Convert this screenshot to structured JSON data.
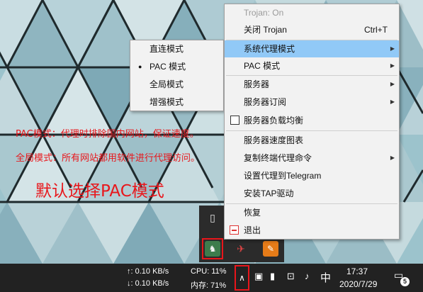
{
  "annotations": {
    "pac_mode": "PAC模式：代理时排除国内网站，保证速度。",
    "global_mode": "全局模式：所有网站都用软件进行代理访问。",
    "default_choice": "默认选择PAC模式"
  },
  "context_menu": {
    "status": "Trojan: On",
    "close_trojan": "关闭 Trojan",
    "close_shortcut": "Ctrl+T",
    "system_proxy_mode": "系统代理模式",
    "pac_mode": "PAC 模式",
    "servers": "服务器",
    "server_subscription": "服务器订阅",
    "server_load_balance": "服务器负载均衡",
    "server_speed_chart": "服务器速度图表",
    "copy_terminal_proxy_cmd": "复制终端代理命令",
    "set_proxy_telegram": "设置代理到Telegram",
    "install_tap_driver": "安装TAP驱动",
    "restore": "恢复",
    "exit": "退出"
  },
  "proxy_submenu": {
    "items": [
      "直连模式",
      "PAC 模式",
      "全局模式",
      "增强模式"
    ],
    "selected_index": 1
  },
  "taskbar": {
    "net_up": "↑: 0.10 KB/s",
    "net_down": "↓: 0.10 KB/s",
    "cpu": "CPU: 11%",
    "memory": "内存: 71%",
    "ime": "中",
    "time": "17:37",
    "date": "2020/7/29",
    "notification_count": "5"
  },
  "icons": {
    "tray_chevron": "chevron-up-icon",
    "usb": "usb-icon",
    "trojan": "trojan-horse-icon",
    "notification": "notification-icon"
  },
  "colors": {
    "annotation_red": "#e8161b",
    "menu_highlight": "#91c9f7",
    "taskbar_bg": "#222222"
  }
}
